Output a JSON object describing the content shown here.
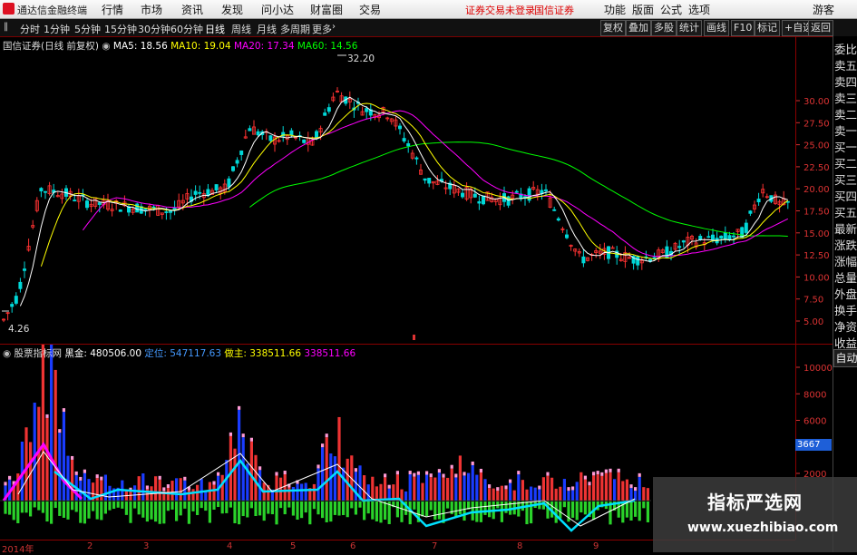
{
  "menubar": {
    "app_title": "通达信金融终端",
    "menus": [
      "行情",
      "市场",
      "资讯",
      "发现",
      "问小达",
      "财富圈",
      "交易"
    ],
    "notice1": "证券交易未登录",
    "notice2": "国信证券",
    "right_menus": [
      "功能",
      "版面",
      "公式",
      "选项"
    ],
    "guest": "游客"
  },
  "toolbar": {
    "periods": [
      "分时",
      "1分钟",
      "5分钟",
      "15分钟",
      "30分钟",
      "60分钟",
      "日线",
      "周线",
      "月线",
      "多周期",
      "更多"
    ],
    "active_period": "日线",
    "right_buttons": [
      "复权",
      "叠加",
      "多股",
      "统计",
      "画线",
      "F10",
      "标记",
      "+自选",
      "返回"
    ]
  },
  "main_legend": {
    "title": "国信证券(日线 前复权)",
    "ma5": "MA5: 18.56",
    "ma10": "MA10: 19.04",
    "ma20": "MA20: 17.34",
    "ma60": "MA60: 14.56",
    "high_label": "32.20",
    "low_label": "4.26"
  },
  "sub_legend": {
    "title": "股票指标网",
    "v1": "黑金: 480506.00",
    "v2": "定位: 547117.63",
    "v3": "做主: 338511.66",
    "v4": "338511.66"
  },
  "price_axis": [
    "30.00",
    "27.50",
    "25.00",
    "22.50",
    "20.00",
    "17.50",
    "15.00",
    "12.50",
    "10.00",
    "7.50",
    "5.00"
  ],
  "vol_axis": [
    "10000",
    "8000",
    "6000",
    "4000",
    "2000"
  ],
  "vol_selected": "3667",
  "time_axis": [
    "2014年",
    "2",
    "3",
    "4",
    "5",
    "6",
    "7",
    "8",
    "9"
  ],
  "right_panel": [
    "委比",
    "卖五",
    "卖四",
    "卖三",
    "卖二",
    "卖一",
    "买一",
    "买二",
    "买三",
    "买四",
    "买五",
    "最新",
    "涨跌",
    "涨幅",
    "总量",
    "外盘",
    "换手",
    "净资",
    "收益"
  ],
  "right_panel_auto": "自动",
  "watermark": {
    "line1": "指标严选网",
    "line2": "www.xuezhibiao.com"
  },
  "colors": {
    "up": "#ff3232",
    "down": "#00d8d8",
    "ma5": "#ffffff",
    "ma10": "#ffff00",
    "ma20": "#ff00ff",
    "ma60": "#00ff00"
  }
}
